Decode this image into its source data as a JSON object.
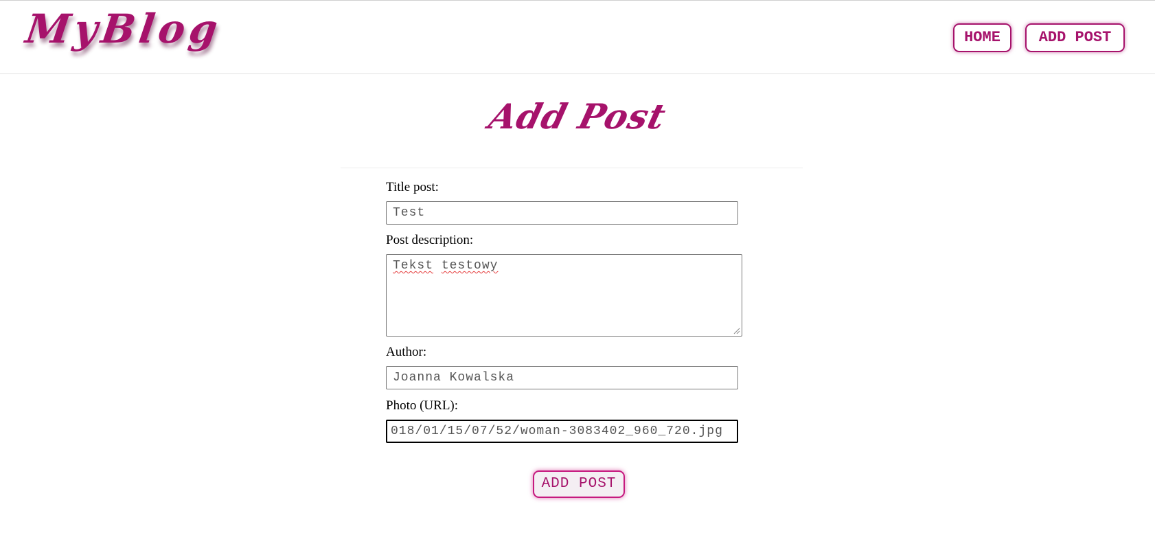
{
  "brand": {
    "logo_text": "MyBlog",
    "accent_color": "#a6126b"
  },
  "nav": {
    "home_label": "HOME",
    "add_post_label": "ADD POST"
  },
  "page": {
    "title": "Add Post"
  },
  "form": {
    "title_label": "Title post:",
    "title_value": "Test",
    "description_label": "Post description:",
    "description_word_1": "Tekst",
    "description_word_2": "testowy",
    "author_label": "Author:",
    "author_value": "Joanna Kowalska",
    "photo_label": "Photo (URL):",
    "photo_value": "018/01/15/07/52/woman-3083402_960_720.jpg",
    "submit_label": "ADD POST"
  }
}
